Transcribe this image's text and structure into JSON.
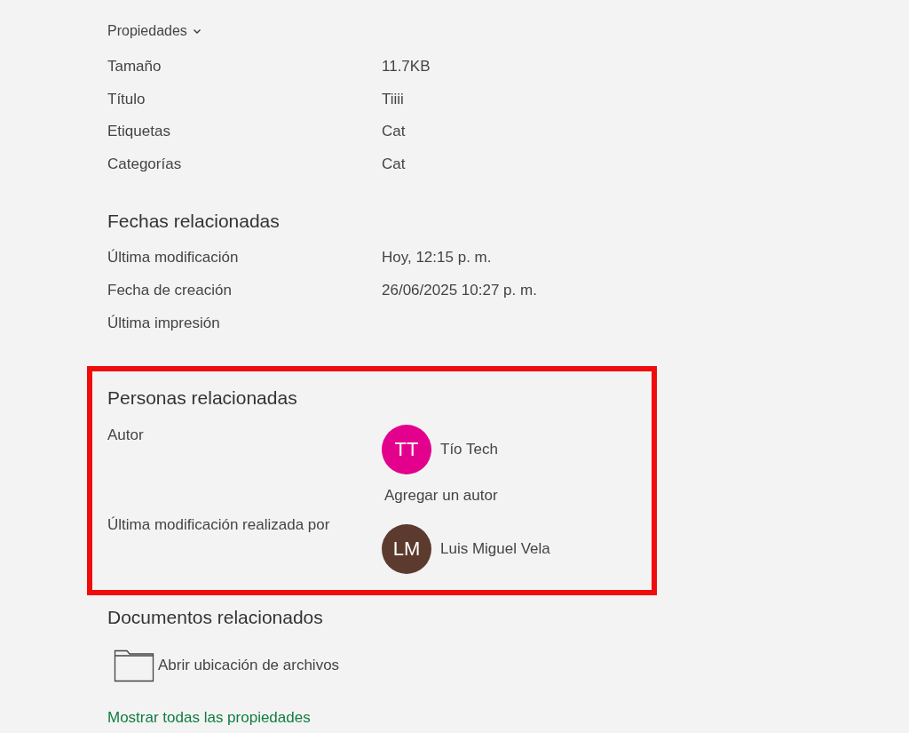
{
  "properties": {
    "heading": "Propiedades",
    "rows": [
      {
        "label": "Tamaño",
        "value": "11.7KB"
      },
      {
        "label": "Título",
        "value": "Tiiii"
      },
      {
        "label": "Etiquetas",
        "value": "Cat"
      },
      {
        "label": "Categorías",
        "value": "Cat"
      }
    ]
  },
  "dates": {
    "heading": "Fechas relacionadas",
    "rows": [
      {
        "label": "Última modificación",
        "value": "Hoy, 12:15 p. m."
      },
      {
        "label": "Fecha de creación",
        "value": "26/06/2025 10:27 p. m."
      },
      {
        "label": "Última impresión"
      }
    ]
  },
  "people": {
    "heading": "Personas relacionadas",
    "highlighted": true,
    "author_label": "Autor",
    "authors": [
      {
        "initials": "TT",
        "name": "Tío Tech",
        "color": "#e3008c"
      }
    ],
    "add_author": "Agregar un autor",
    "modified_by_label": "Última modificación realizada por",
    "modified_by": {
      "initials": "LM",
      "name": "Luis Miguel Vela",
      "color": "#5c3b2e"
    }
  },
  "documents": {
    "heading": "Documentos relacionados",
    "open_location": "Abrir ubicación de archivos"
  },
  "show_all": "Mostrar todas las propiedades"
}
